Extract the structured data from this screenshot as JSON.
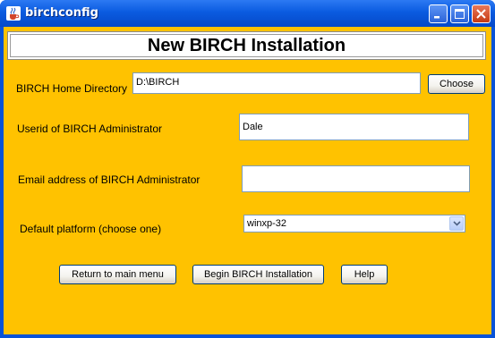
{
  "window": {
    "title": "birchconfig"
  },
  "header": {
    "title": "New BIRCH Installation"
  },
  "form": {
    "home_dir_label": "BIRCH Home Directory",
    "home_dir_value": "D:\\BIRCH",
    "choose_label": "Choose",
    "userid_label": "Userid of BIRCH Administrator",
    "userid_value": "Dale",
    "email_label": "Email address of BIRCH Administrator",
    "email_value": "",
    "platform_label": "Default platform (choose one)",
    "platform_value": "winxp-32"
  },
  "buttons": {
    "return_label": "Return to main menu",
    "begin_label": "Begin BIRCH Installation",
    "help_label": "Help"
  },
  "colors": {
    "background": "#ffc200",
    "titlebar": "#0a5be0"
  }
}
